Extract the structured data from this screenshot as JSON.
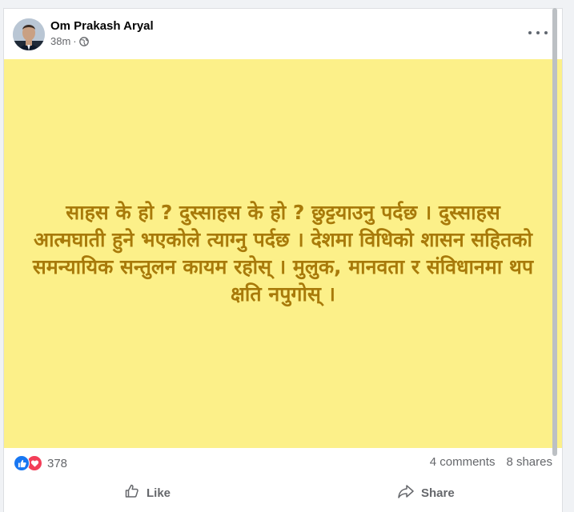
{
  "post": {
    "author": "Om Prakash Aryal",
    "timestamp": "38m",
    "separator": "·",
    "privacy_icon": "globe-icon",
    "text": "साहस के हो ? दुस्साहस के हो ? छुट्टयाउनु पर्दछ । दुस्साहस आत्मघाती हुने भएकोले त्याग्नु पर्दछ । देशमा विधिको शासन सहितको समन्यायिक सन्तुलन कायम रहोस् । मुलुक, मानवता र संविधानमा थप क्षति नपुगोस् ।",
    "background_color": "#fcf089",
    "text_color": "#a87a0a"
  },
  "reactions": {
    "count": "378",
    "icons": [
      "like-icon",
      "love-icon"
    ]
  },
  "stats": {
    "comments": "4 comments",
    "shares": "8 shares"
  },
  "actions": {
    "like_label": "Like",
    "share_label": "Share"
  },
  "colors": {
    "accent": "#1877f2",
    "love": "#f33e58",
    "muted_text": "#65676b"
  }
}
